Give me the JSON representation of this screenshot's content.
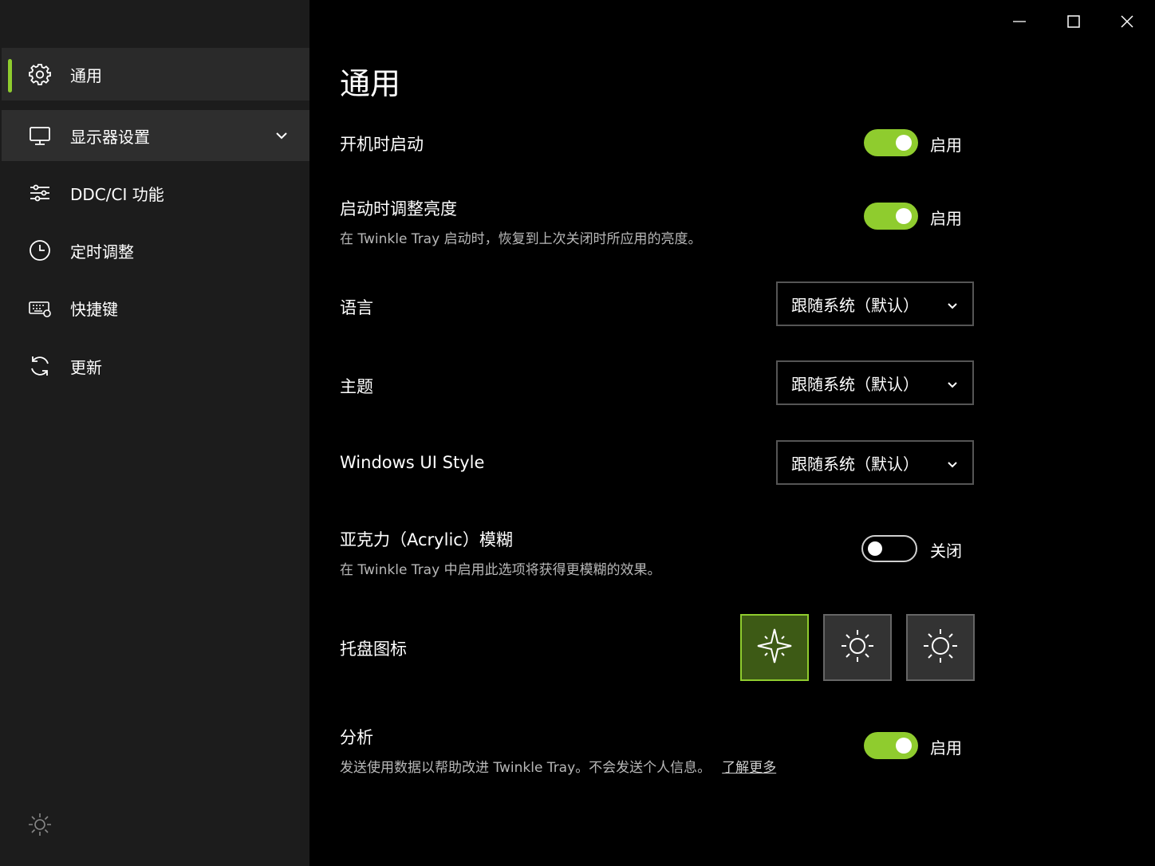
{
  "sidebar": {
    "items": [
      {
        "label": "通用",
        "icon": "gear-icon"
      },
      {
        "label": "显示器设置",
        "icon": "monitor-icon"
      },
      {
        "label": "DDC/CI 功能",
        "icon": "sliders-icon"
      },
      {
        "label": "定时调整",
        "icon": "clock-icon"
      },
      {
        "label": "快捷键",
        "icon": "keyboard-icon"
      },
      {
        "label": "更新",
        "icon": "refresh-icon"
      }
    ],
    "footer_icon": "sun-icon"
  },
  "page": {
    "title": "通用",
    "startup": {
      "label": "开机时启动",
      "state": "启用",
      "enabled": true
    },
    "restore_brightness": {
      "label": "启动时调整亮度",
      "description": "在 Twinkle Tray 启动时，恢复到上次关闭时所应用的亮度。",
      "state": "启用",
      "enabled": true
    },
    "language": {
      "label": "语言",
      "value": "跟随系统（默认）"
    },
    "theme": {
      "label": "主题",
      "value": "跟随系统（默认）"
    },
    "ui_style": {
      "label": "Windows UI Style",
      "value": "跟随系统（默认）"
    },
    "acrylic": {
      "label": "亚克力（Acrylic）模糊",
      "description": "在 Twinkle Tray 中启用此选项将获得更模糊的效果。",
      "state": "关闭",
      "enabled": false
    },
    "tray_icon": {
      "label": "托盘图标",
      "options": [
        "sparkle-icon",
        "sun-icon",
        "sun-outline-icon"
      ],
      "selected_index": 0
    },
    "analytics": {
      "label": "分析",
      "description": "发送使用数据以帮助改进 Twinkle Tray。不会发送个人信息。",
      "link": "了解更多",
      "state": "启用",
      "enabled": true
    }
  },
  "colors": {
    "accent": "#8fcc2e",
    "sidebar_bg": "#1c1c1c",
    "main_bg": "#000000"
  }
}
